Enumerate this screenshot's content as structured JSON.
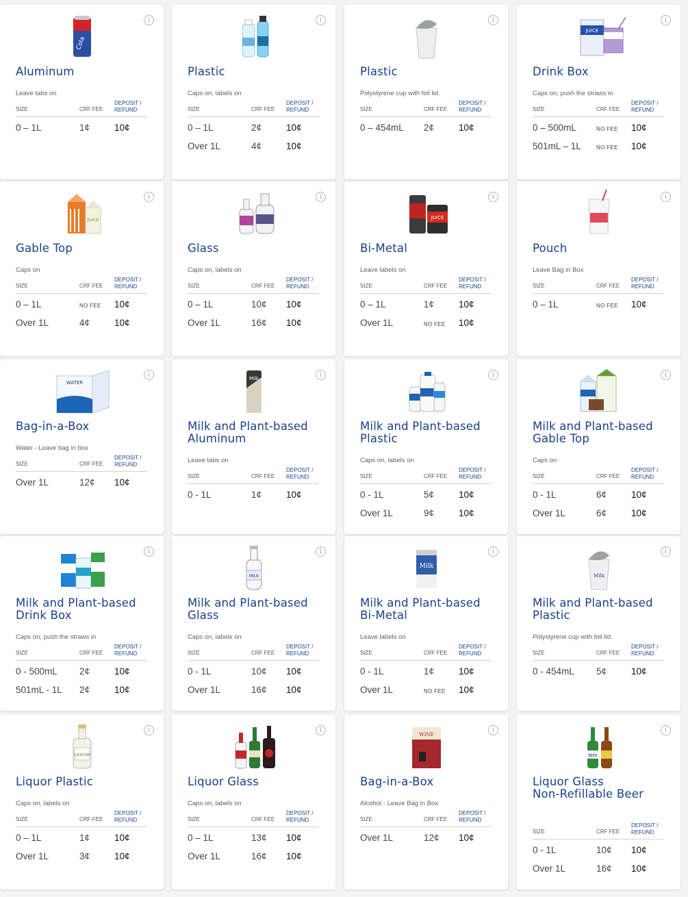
{
  "headers": {
    "size": "SIZE",
    "crf_fee": "CRF FEE",
    "deposit_line1": "DEPOSIT /",
    "deposit_line2": "REFUND"
  },
  "cards": [
    {
      "id": "aluminum",
      "title": [
        "Aluminum"
      ],
      "subtitle": "Leave tabs on",
      "image": "aluminum-can-icon",
      "rows": [
        {
          "size": "0 – 1L",
          "fee": "1¢",
          "deposit": "10¢"
        }
      ]
    },
    {
      "id": "plastic",
      "title": [
        "Plastic"
      ],
      "subtitle": "Caps on, labels on",
      "image": "plastic-bottles-icon",
      "rows": [
        {
          "size": "0 – 1L",
          "fee": "2¢",
          "deposit": "10¢"
        },
        {
          "size": "Over 1L",
          "fee": "4¢",
          "deposit": "10¢"
        }
      ]
    },
    {
      "id": "plastic-cup",
      "title": [
        "Plastic"
      ],
      "subtitle": "Polystyrene cup with foil lid.",
      "image": "plastic-cup-icon",
      "rows": [
        {
          "size": "0 – 454mL",
          "fee": "2¢",
          "deposit": "10¢"
        }
      ]
    },
    {
      "id": "drink-box",
      "title": [
        "Drink Box"
      ],
      "subtitle": "Caps on, push the straws in",
      "image": "drink-box-icon",
      "rows": [
        {
          "size": "0 – 500mL",
          "fee": "NO FEE",
          "deposit": "10¢"
        },
        {
          "size": "501mL – 1L",
          "fee": "NO FEE",
          "deposit": "10¢"
        }
      ]
    },
    {
      "id": "gable-top",
      "title": [
        "Gable Top"
      ],
      "subtitle": "Caps on",
      "image": "gable-top-carton-icon",
      "rows": [
        {
          "size": "0 – 1L",
          "fee": "NO FEE",
          "deposit": "10¢"
        },
        {
          "size": "Over 1L",
          "fee": "4¢",
          "deposit": "10¢"
        }
      ]
    },
    {
      "id": "glass",
      "title": [
        "Glass"
      ],
      "subtitle": "Caps on, labels on",
      "image": "glass-bottles-icon",
      "rows": [
        {
          "size": "0 – 1L",
          "fee": "10¢",
          "deposit": "10¢"
        },
        {
          "size": "Over 1L",
          "fee": "16¢",
          "deposit": "10¢"
        }
      ]
    },
    {
      "id": "bi-metal",
      "title": [
        "Bi-Metal"
      ],
      "subtitle": "Leave labels on",
      "image": "bi-metal-cans-icon",
      "rows": [
        {
          "size": "0 – 1L",
          "fee": "1¢",
          "deposit": "10¢"
        },
        {
          "size": "Over 1L",
          "fee": "NO FEE",
          "deposit": "10¢"
        }
      ]
    },
    {
      "id": "pouch",
      "title": [
        "Pouch"
      ],
      "subtitle": "Leave Bag in Box",
      "image": "pouch-icon",
      "rows": [
        {
          "size": "0 – 1L",
          "fee": "NO FEE",
          "deposit": "10¢"
        }
      ]
    },
    {
      "id": "bag-in-box-water",
      "title": [
        "Bag-in-a-Box"
      ],
      "subtitle": "Water - Leave bag in box",
      "image": "water-bag-in-box-icon",
      "rows": [
        {
          "size": "Over 1L",
          "fee": "12¢",
          "deposit": "10¢"
        }
      ]
    },
    {
      "id": "milk-aluminum",
      "title": [
        "Milk and Plant-based",
        "Aluminum"
      ],
      "subtitle": "Leave tabs on",
      "image": "milk-can-icon",
      "rows": [
        {
          "size": "0 - 1L",
          "fee": "1¢",
          "deposit": "10¢"
        }
      ]
    },
    {
      "id": "milk-plastic",
      "title": [
        "Milk and Plant-based",
        "Plastic"
      ],
      "subtitle": "Caps on, labels on",
      "image": "milk-jugs-icon",
      "rows": [
        {
          "size": "0 - 1L",
          "fee": "5¢",
          "deposit": "10¢"
        },
        {
          "size": "Over 1L",
          "fee": "9¢",
          "deposit": "10¢"
        }
      ]
    },
    {
      "id": "milk-gable-top",
      "title": [
        "Milk and Plant-based",
        "Gable Top"
      ],
      "subtitle": "Caps on",
      "image": "milk-cartons-icon",
      "rows": [
        {
          "size": "0 - 1L",
          "fee": "6¢",
          "deposit": "10¢"
        },
        {
          "size": "Over 1L",
          "fee": "6¢",
          "deposit": "10¢"
        }
      ]
    },
    {
      "id": "milk-drink-box",
      "title": [
        "Milk and Plant-based",
        "Drink Box"
      ],
      "subtitle": "Caps on, push the straws in",
      "image": "milk-drink-boxes-icon",
      "rows": [
        {
          "size": "0 - 500mL",
          "fee": "2¢",
          "deposit": "10¢"
        },
        {
          "size": "501mL - 1L",
          "fee": "2¢",
          "deposit": "10¢"
        }
      ]
    },
    {
      "id": "milk-glass",
      "title": [
        "Milk and Plant-based",
        "Glass"
      ],
      "subtitle": "Caps on, labels on",
      "image": "milk-glass-bottle-icon",
      "rows": [
        {
          "size": "0 - 1L",
          "fee": "10¢",
          "deposit": "10¢"
        },
        {
          "size": "Over 1L",
          "fee": "16¢",
          "deposit": "10¢"
        }
      ]
    },
    {
      "id": "milk-bi-metal",
      "title": [
        "Milk and Plant-based",
        "Bi-Metal"
      ],
      "subtitle": "Leave labels on",
      "image": "milk-bi-metal-can-icon",
      "rows": [
        {
          "size": "0 - 1L",
          "fee": "1¢",
          "deposit": "10¢"
        },
        {
          "size": "Over 1L",
          "fee": "NO FEE",
          "deposit": "10¢"
        }
      ]
    },
    {
      "id": "milk-plastic-cup",
      "title": [
        "Milk and Plant-based",
        "Plastic"
      ],
      "subtitle": "Polystyrene cup with foil lid.",
      "image": "milk-cup-icon",
      "rows": [
        {
          "size": "0 - 454mL",
          "fee": "5¢",
          "deposit": "10¢"
        }
      ]
    },
    {
      "id": "liquor-plastic",
      "title": [
        "Liquor Plastic"
      ],
      "subtitle": "Caps on, labels on",
      "image": "liquor-plastic-bottle-icon",
      "rows": [
        {
          "size": "0 – 1L",
          "fee": "1¢",
          "deposit": "10¢"
        },
        {
          "size": "Over 1L",
          "fee": "3¢",
          "deposit": "10¢"
        }
      ]
    },
    {
      "id": "liquor-glass",
      "title": [
        "Liquor Glass"
      ],
      "subtitle": "Caps on, labels on",
      "image": "liquor-glass-bottles-icon",
      "rows": [
        {
          "size": "0 – 1L",
          "fee": "13¢",
          "deposit": "10¢"
        },
        {
          "size": "Over 1L",
          "fee": "16¢",
          "deposit": "10¢"
        }
      ]
    },
    {
      "id": "bag-in-box-alcohol",
      "title": [
        "Bag-in-a-Box"
      ],
      "subtitle": "Alcohol - Leave Bag in Box",
      "image": "wine-box-icon",
      "rows": [
        {
          "size": "Over 1L",
          "fee": "12¢",
          "deposit": "10¢"
        }
      ]
    },
    {
      "id": "non-refillable-beer",
      "title": [
        "Liquor Glass",
        "Non-Refillable Beer"
      ],
      "subtitle": "",
      "image": "beer-bottles-icon",
      "rows": [
        {
          "size": "0 - 1L",
          "fee": "10¢",
          "deposit": "10¢"
        },
        {
          "size": "Over 1L",
          "fee": "16¢",
          "deposit": "10¢"
        }
      ]
    }
  ]
}
